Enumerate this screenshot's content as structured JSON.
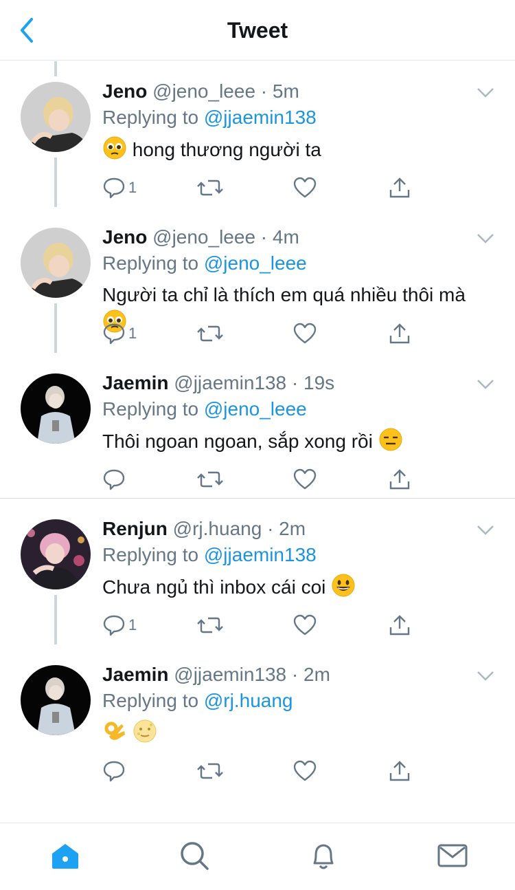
{
  "header": {
    "title": "Tweet",
    "back_icon": "chevron-left-icon"
  },
  "tweets": [
    {
      "name": "Jeno",
      "handle": "@jeno_leee",
      "time": "5m",
      "replying_prefix": "Replying to",
      "replying_to": "@jjaemin138",
      "text_before": "",
      "text_after": " hong thương người ta",
      "emojis": [
        "pleading-face"
      ],
      "reply_count": "1"
    },
    {
      "name": "Jeno",
      "handle": "@jeno_leee",
      "time": "4m",
      "replying_prefix": "Replying to",
      "replying_to": "@jeno_leee",
      "text_before": "Người ta chỉ là thích em quá nhiều thôi mà ",
      "text_after": "",
      "emojis": [
        "pleading-face"
      ],
      "reply_count": "1"
    },
    {
      "name": "Jaemin",
      "handle": "@jjaemin138",
      "time": "19s",
      "replying_prefix": "Replying to",
      "replying_to": "@jeno_leee",
      "text_before": "Thôi ngoan ngoan, sắp xong rồi ",
      "text_after": "",
      "emojis": [
        "expressionless-face"
      ],
      "reply_count": ""
    },
    {
      "name": "Renjun",
      "handle": "@rj.huang",
      "time": "2m",
      "replying_prefix": "Replying to",
      "replying_to": "@jjaemin138",
      "text_before": "Chưa ngủ thì inbox cái coi ",
      "text_after": "",
      "emojis": [
        "grinning-face"
      ],
      "reply_count": "1"
    },
    {
      "name": "Jaemin",
      "handle": "@jjaemin138",
      "time": "2m",
      "replying_prefix": "Replying to",
      "replying_to": "@rj.huang",
      "text_before": "",
      "text_after": "",
      "emojis": [
        "ok-hand",
        "moon-face"
      ],
      "reply_count": ""
    }
  ],
  "actions": [
    "reply-icon",
    "retweet-icon",
    "like-icon",
    "share-icon"
  ],
  "tabbar": [
    "home-icon",
    "search-icon",
    "notifications-icon",
    "messages-icon"
  ],
  "colors": {
    "accent": "#1da1f2",
    "link": "#1b95e0",
    "muted": "#657786",
    "text": "#14171a",
    "thread": "#ccd6dd",
    "divider": "#e1e8ed",
    "emoji": "#fcc21b"
  }
}
